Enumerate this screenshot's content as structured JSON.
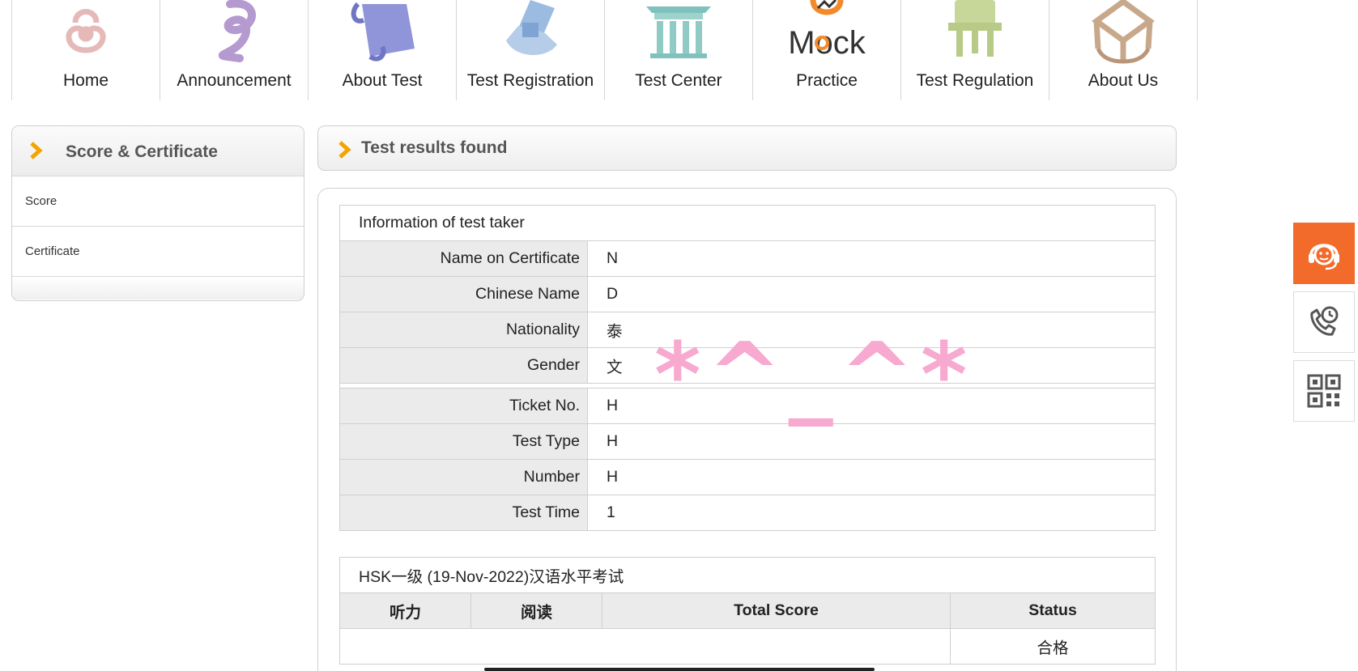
{
  "nav": {
    "items": [
      {
        "label": "Home",
        "icon": "home-icon"
      },
      {
        "label": "Announcement",
        "icon": "announcement-icon"
      },
      {
        "label": "About Test",
        "icon": "scroll-icon"
      },
      {
        "label": "Test Registration",
        "icon": "registration-icon"
      },
      {
        "label": "Test Center",
        "icon": "building-icon"
      },
      {
        "label": "Practice",
        "icon": "mock-logo-icon"
      },
      {
        "label": "Test Regulation",
        "icon": "bronze-vessel-icon"
      },
      {
        "label": "About Us",
        "icon": "about-us-icon"
      }
    ],
    "mock_word": "Mock"
  },
  "sidebar": {
    "title": "Score & Certificate",
    "links": [
      "Score",
      "Certificate"
    ]
  },
  "result": {
    "title": "Test results found",
    "info_caption": "Information of test taker",
    "rows": [
      {
        "label": "Name on Certificate",
        "value": "N"
      },
      {
        "label": "Chinese Name",
        "value": "D"
      },
      {
        "label": "Nationality",
        "value": "泰"
      },
      {
        "label": "Gender",
        "value": "文"
      },
      {
        "label": "Ticket No.",
        "value": "H"
      },
      {
        "label": "Test Type",
        "value": "H"
      },
      {
        "label": "Number",
        "value": "H"
      },
      {
        "label": "Test Time",
        "value": "1"
      }
    ],
    "overlay_text": "*^_^*",
    "score_caption": "HSK一级 (19-Nov-2022)汉语水平考试",
    "score_headers": [
      "听力",
      "阅读",
      "Total Score",
      "Status"
    ],
    "status_value": "合格"
  },
  "floating": {
    "icons": [
      "customer-service-icon",
      "phone-clock-icon",
      "qr-code-icon"
    ],
    "accent": "#f26b2b"
  }
}
